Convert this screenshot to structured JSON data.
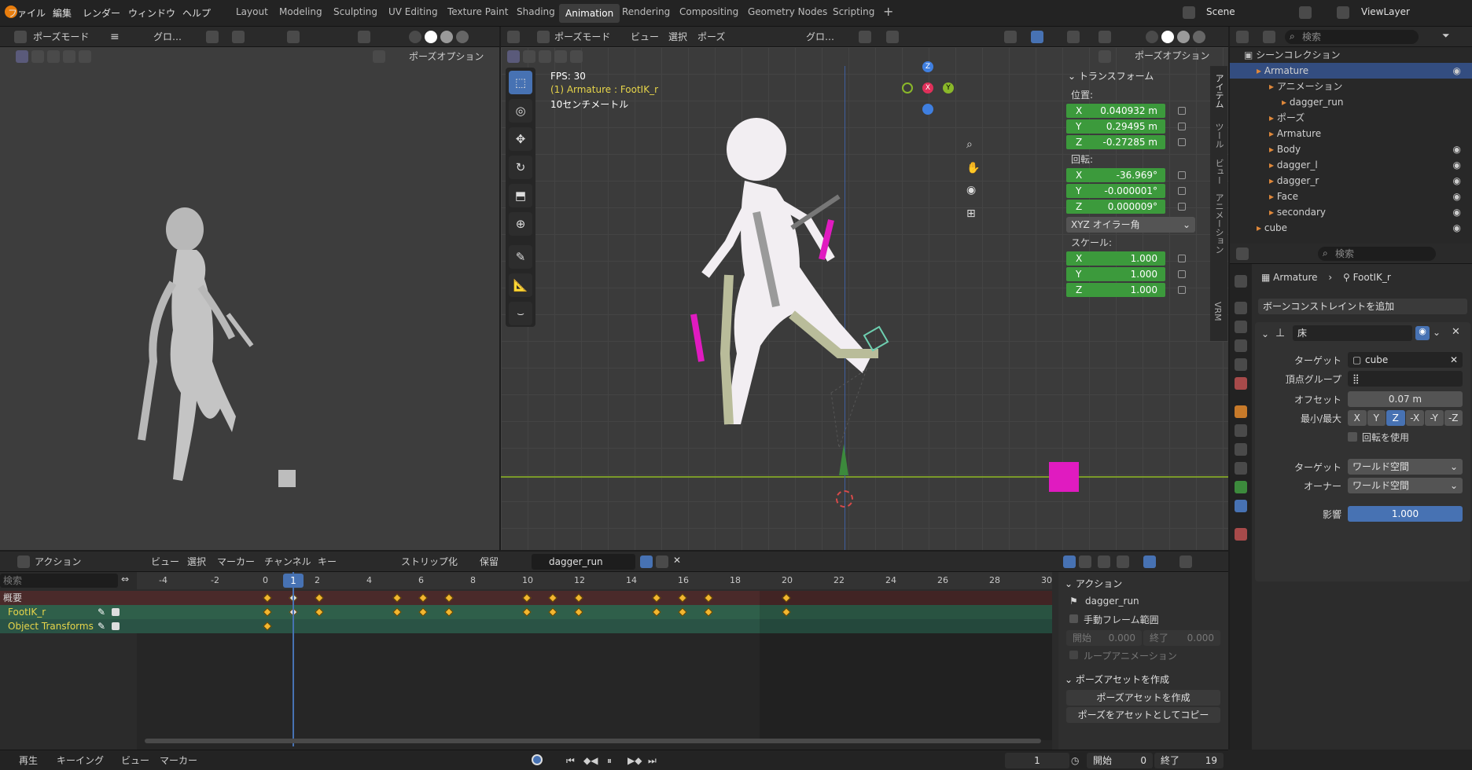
{
  "menu": [
    "ファイル",
    "編集",
    "レンダー",
    "ウィンドウ",
    "ヘルプ"
  ],
  "workspaces": [
    "Layout",
    "Modeling",
    "Sculpting",
    "UV Editing",
    "Texture Paint",
    "Shading",
    "Animation",
    "Rendering",
    "Compositing",
    "Geometry Nodes",
    "Scripting"
  ],
  "active_workspace": "Animation",
  "scene_name": "Scene",
  "view_layer": "ViewLayer",
  "left_viewport": {
    "mode": "ポーズモード",
    "transform": "グロ…",
    "pose_options": "ポーズオプション"
  },
  "main_viewport": {
    "mode": "ポーズモード",
    "menu": [
      "ビュー",
      "選択",
      "ポーズ"
    ],
    "transform": "グロ…",
    "pose_options": "ポーズオプション",
    "fps": "FPS: 30",
    "object_info": "(1) Armature : FootIK_r",
    "scale_info": "10センチメートル"
  },
  "n_panel": {
    "title": "トランスフォーム",
    "location_label": "位置:",
    "location": [
      {
        "axis": "X",
        "value": "0.040932 m"
      },
      {
        "axis": "Y",
        "value": "0.29495 m"
      },
      {
        "axis": "Z",
        "value": "-0.27285 m"
      }
    ],
    "rotation_label": "回転:",
    "rotation": [
      {
        "axis": "X",
        "value": "-36.969°"
      },
      {
        "axis": "Y",
        "value": "-0.000001°"
      },
      {
        "axis": "Z",
        "value": "0.000009°"
      }
    ],
    "rotation_mode": "XYZ オイラー角",
    "scale_label": "スケール:",
    "scale": [
      {
        "axis": "X",
        "value": "1.000"
      },
      {
        "axis": "Y",
        "value": "1.000"
      },
      {
        "axis": "Z",
        "value": "1.000"
      }
    ],
    "tabs": [
      "アイテム",
      "ツール",
      "ビュー",
      "アニメーション",
      "VRM"
    ]
  },
  "outliner": {
    "search_placeholder": "検索",
    "root": "シーンコレクション",
    "items": [
      {
        "label": "Armature",
        "indent": 1,
        "selected": true
      },
      {
        "label": "アニメーション",
        "indent": 2
      },
      {
        "label": "dagger_run",
        "indent": 3
      },
      {
        "label": "ポーズ",
        "indent": 2
      },
      {
        "label": "Armature",
        "indent": 2
      },
      {
        "label": "Body",
        "indent": 2
      },
      {
        "label": "dagger_l",
        "indent": 2
      },
      {
        "label": "dagger_r",
        "indent": 2
      },
      {
        "label": "Face",
        "indent": 2
      },
      {
        "label": "secondary",
        "indent": 2
      },
      {
        "label": "cube",
        "indent": 1
      }
    ]
  },
  "properties": {
    "search_placeholder": "検索",
    "breadcrumb": [
      "Armature",
      "FootIK_r"
    ],
    "add_constraint": "ボーンコンストレイントを追加",
    "constraint_name": "床",
    "target_label": "ターゲット",
    "target_value": "cube",
    "vertex_group_label": "頂点グループ",
    "offset_label": "オフセット",
    "offset_value": "0.07 m",
    "minmax_label": "最小/最大",
    "axes": [
      "X",
      "Y",
      "Z",
      "-X",
      "-Y",
      "-Z"
    ],
    "active_axis": "Z",
    "use_rotation": "回転を使用",
    "target_space_label": "ターゲット",
    "target_space": "ワールド空間",
    "owner_space_label": "オーナー",
    "owner_space": "ワールド空間",
    "influence_label": "影響",
    "influence_value": "1.000"
  },
  "dopesheet": {
    "mode": "アクション",
    "menu": [
      "ビュー",
      "選択",
      "マーカー",
      "チャンネル",
      "キー"
    ],
    "push_down": "ストリップ化",
    "stash": "保留",
    "action_name": "dagger_run",
    "search_placeholder": "検索",
    "channels": [
      "概要",
      "FootIK_r",
      "Object Transforms"
    ],
    "ruler": [
      "-4",
      "-2",
      "0",
      "1",
      "2",
      "4",
      "6",
      "8",
      "10",
      "12",
      "14",
      "16",
      "18",
      "20",
      "22",
      "24",
      "26",
      "28",
      "30"
    ],
    "current_frame": 1,
    "keyframes_summary": [
      0,
      1,
      2,
      5,
      6,
      7,
      10,
      11,
      12,
      15,
      16,
      17,
      20
    ],
    "keyframes_foot": [
      0,
      1,
      2,
      5,
      6,
      7,
      10,
      11,
      12,
      15,
      16,
      17,
      20
    ],
    "keyframes_object": [
      0
    ]
  },
  "action_panel": {
    "title": "アクション",
    "name": "dagger_run",
    "manual_range": "手動フレーム範囲",
    "start_label": "開始",
    "start_value": "0.000",
    "end_label": "終了",
    "end_value": "0.000",
    "loop": "ループアニメーション",
    "pose_asset_title": "ポーズアセットを作成",
    "create_pose_asset": "ポーズアセットを作成",
    "copy_pose_asset": "ポーズをアセットとしてコピー"
  },
  "playback": {
    "menu": [
      "再生",
      "キーイング",
      "ビュー",
      "マーカー"
    ],
    "frame": "1",
    "start_label": "開始",
    "start": "0",
    "end_label": "終了",
    "end": "19"
  }
}
